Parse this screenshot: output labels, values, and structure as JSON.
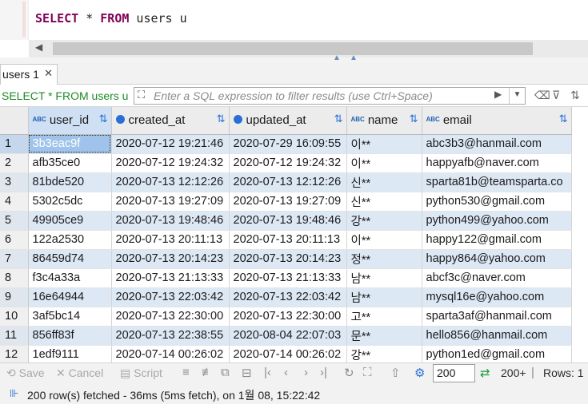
{
  "editor": {
    "sql_keyword_select": "SELECT",
    "sql_star": " * ",
    "sql_keyword_from": "FROM",
    "sql_rest": " users u"
  },
  "results_tab": {
    "label": "users 1"
  },
  "filter": {
    "query_label": "SELECT * FROM users u",
    "placeholder": "Enter a SQL expression to filter results (use Ctrl+Space)"
  },
  "grid": {
    "columns": [
      {
        "name": "user_id",
        "type_icon": "ABC"
      },
      {
        "name": "created_at",
        "type_icon": "clock-icon"
      },
      {
        "name": "updated_at",
        "type_icon": "clock-icon"
      },
      {
        "name": "name",
        "type_icon": "ABC"
      },
      {
        "name": "email",
        "type_icon": "ABC"
      }
    ],
    "rows": [
      {
        "n": "1",
        "user_id": "3b3eac9f",
        "created_at": "2020-07-12 19:21:46",
        "updated_at": "2020-07-29 16:09:55",
        "name": "이**",
        "email": "abc3b3@hanmail.com"
      },
      {
        "n": "2",
        "user_id": "afb35ce0",
        "created_at": "2020-07-12 19:24:32",
        "updated_at": "2020-07-12 19:24:32",
        "name": "이**",
        "email": "happyafb@naver.com"
      },
      {
        "n": "3",
        "user_id": "81bde520",
        "created_at": "2020-07-13 12:12:26",
        "updated_at": "2020-07-13 12:12:26",
        "name": "신**",
        "email": "sparta81b@teamsparta.co"
      },
      {
        "n": "4",
        "user_id": "5302c5dc",
        "created_at": "2020-07-13 19:27:09",
        "updated_at": "2020-07-13 19:27:09",
        "name": "신**",
        "email": "python530@gmail.com"
      },
      {
        "n": "5",
        "user_id": "49905ce9",
        "created_at": "2020-07-13 19:48:46",
        "updated_at": "2020-07-13 19:48:46",
        "name": "강**",
        "email": "python499@yahoo.com"
      },
      {
        "n": "6",
        "user_id": "122a2530",
        "created_at": "2020-07-13 20:11:13",
        "updated_at": "2020-07-13 20:11:13",
        "name": "이**",
        "email": "happy122@gmail.com"
      },
      {
        "n": "7",
        "user_id": "86459d74",
        "created_at": "2020-07-13 20:14:23",
        "updated_at": "2020-07-13 20:14:23",
        "name": "정**",
        "email": "happy864@yahoo.com"
      },
      {
        "n": "8",
        "user_id": "f3c4a33a",
        "created_at": "2020-07-13 21:13:33",
        "updated_at": "2020-07-13 21:13:33",
        "name": "남**",
        "email": "abcf3c@naver.com"
      },
      {
        "n": "9",
        "user_id": "16e64944",
        "created_at": "2020-07-13 22:03:42",
        "updated_at": "2020-07-13 22:03:42",
        "name": "남**",
        "email": "mysql16e@yahoo.com"
      },
      {
        "n": "10",
        "user_id": "3af5bc14",
        "created_at": "2020-07-13 22:30:00",
        "updated_at": "2020-07-13 22:30:00",
        "name": "고**",
        "email": "sparta3af@hanmail.com"
      },
      {
        "n": "11",
        "user_id": "856ff83f",
        "created_at": "2020-07-13 22:38:55",
        "updated_at": "2020-08-04 22:07:03",
        "name": "문**",
        "email": "hello856@hanmail.com"
      },
      {
        "n": "12",
        "user_id": "1edf9111",
        "created_at": "2020-07-14 00:26:02",
        "updated_at": "2020-07-14 00:26:02",
        "name": "강**",
        "email": "python1ed@gmail.com"
      }
    ]
  },
  "toolbar": {
    "save": "Save",
    "cancel": "Cancel",
    "script": "Script",
    "fetch_size": "200",
    "fetch_more": "200+",
    "rows": "Rows: 1"
  },
  "status": {
    "text": "200 row(s) fetched - 36ms (5ms fetch), on 1월 08, 15:22:42"
  }
}
